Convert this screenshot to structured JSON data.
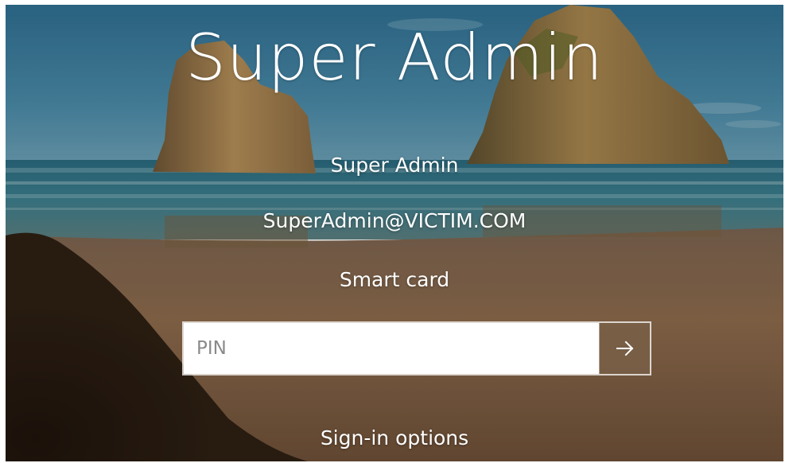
{
  "lock_screen": {
    "big_user_name": "Super Admin",
    "display_name": "Super Admin",
    "email": "SuperAdmin@VICTIM.COM",
    "sign_in_method": "Smart card",
    "pin_field": {
      "placeholder": "PIN",
      "value": ""
    },
    "submit_icon": "arrow-right-icon",
    "sign_in_options_label": "Sign-in options"
  },
  "colors": {
    "sky": "#3f7f9e",
    "sea": "#2f6e82",
    "sand": "#8a6a4c",
    "rock": "#a37e4f",
    "submit_button": "#785f46",
    "text": "#ffffff"
  }
}
